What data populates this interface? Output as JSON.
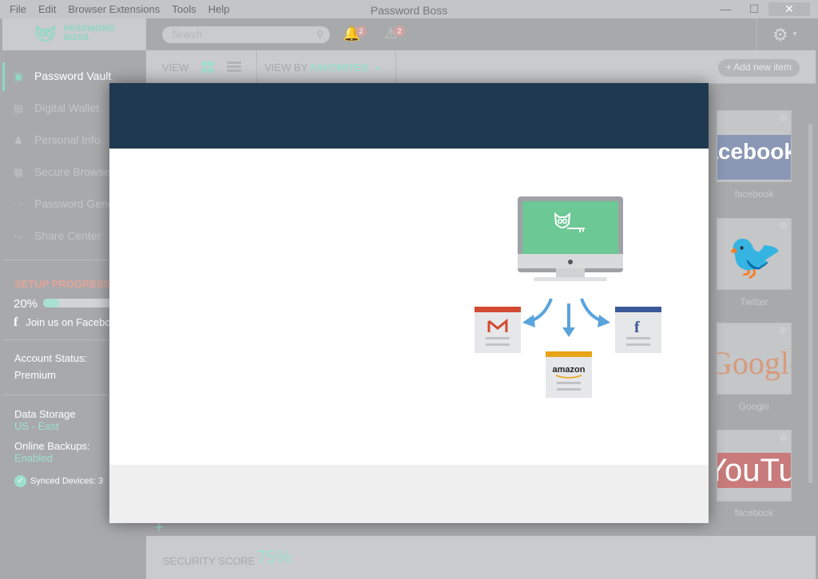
{
  "window": {
    "title": "Password Boss",
    "menu": [
      "File",
      "Edit",
      "Browser Extensions",
      "Tools",
      "Help"
    ],
    "controls": [
      "—",
      "☐",
      "✕"
    ]
  },
  "header": {
    "logo_line1": "PASSWORD",
    "logo_line2": "BOSS",
    "search_placeholder": "Search",
    "notifications_count": "2",
    "alerts_count": "2"
  },
  "sidebar": {
    "items": [
      {
        "label": "Password Vault",
        "icon": "vault-icon",
        "active": true
      },
      {
        "label": "Digital Wallet",
        "icon": "wallet-icon"
      },
      {
        "label": "Personal Info",
        "icon": "person-icon"
      },
      {
        "label": "Secure Browser",
        "icon": "browser-icon"
      },
      {
        "label": "Password Generator",
        "icon": "generator-icon"
      },
      {
        "label": "Share Center",
        "icon": "share-icon"
      }
    ],
    "setup_progress_label": "SETUP PROGRESS",
    "setup_progress_pct": "20%",
    "setup_progress_value": 0.2,
    "facebook_join": "Join us on Facebook",
    "account_status_label": "Account Status:",
    "account_status_value": "Premium",
    "data_storage_label": "Data Storage",
    "data_storage_value": "US - East",
    "online_backups_label": "Online Backups:",
    "online_backups_value": "Enabled",
    "synced_devices_label": "Synced Devices:",
    "synced_devices_value": "3"
  },
  "toolbar": {
    "view_label": "VIEW",
    "view_by_label": "VIEW BY",
    "view_by_value": "FAVORITES",
    "add_new_item": "+ Add new item"
  },
  "tiles": [
    {
      "label": "facebook",
      "logo_text": "facebook"
    },
    {
      "label": "Twitter",
      "logo_text": ""
    },
    {
      "label": "Google",
      "logo_text": "Google"
    },
    {
      "label": "facebook",
      "logo_text": "YouTube"
    }
  ],
  "footer": {
    "security_score_label": "SECURITY SCORE",
    "security_score_value": "75%"
  },
  "modal": {
    "illustration_brand_label": "amazon"
  },
  "colors": {
    "accent": "#8fd9c2",
    "modal_header": "#1f3a50",
    "setup_title": "#e3a49a"
  }
}
